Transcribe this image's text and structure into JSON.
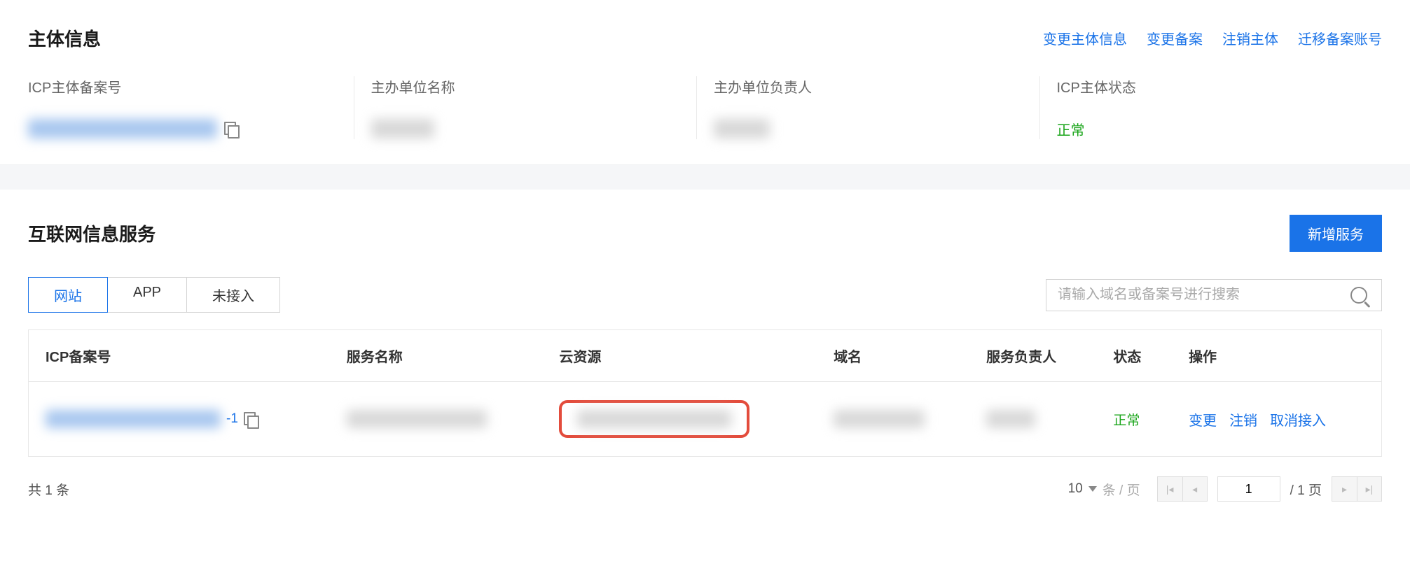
{
  "subject": {
    "title": "主体信息",
    "links": {
      "modify_subject": "变更主体信息",
      "modify_record": "变更备案",
      "cancel_subject": "注销主体",
      "transfer_account": "迁移备案账号"
    },
    "cols": {
      "icp_sub_no": {
        "label": "ICP主体备案号",
        "value_blur": "██████████████"
      },
      "org_name": {
        "label": "主办单位名称",
        "value_blur": "█████"
      },
      "org_owner": {
        "label": "主办单位负责人",
        "value_blur": "████"
      },
      "status": {
        "label": "ICP主体状态",
        "value": "正常"
      }
    }
  },
  "service": {
    "title": "互联网信息服务",
    "add_btn": "新增服务",
    "tabs": {
      "web": "网站",
      "app": "APP",
      "na": "未接入"
    },
    "search_placeholder": "请输入域名或备案号进行搜索",
    "columns": {
      "icp_no": "ICP备案号",
      "svc_name": "服务名称",
      "cloud_res": "云资源",
      "domain": "域名",
      "svc_owner": "服务负责人",
      "status": "状态",
      "ops": "操作"
    },
    "row": {
      "icp_no_blur": "██████████████",
      "icp_no_suffix": "-1",
      "svc_name_blur": "███████████",
      "cloud_res_blur": "█████████████",
      "domain_blur": "████████",
      "svc_owner_blur": "████",
      "status": "正常",
      "ops": {
        "change": "变更",
        "cancel": "注销",
        "unbind": "取消接入"
      }
    },
    "pagination": {
      "total_label": "共 1 条",
      "page_size": "10",
      "per_page": "条 / 页",
      "page_current": "1",
      "page_total": "/ 1 页"
    }
  }
}
